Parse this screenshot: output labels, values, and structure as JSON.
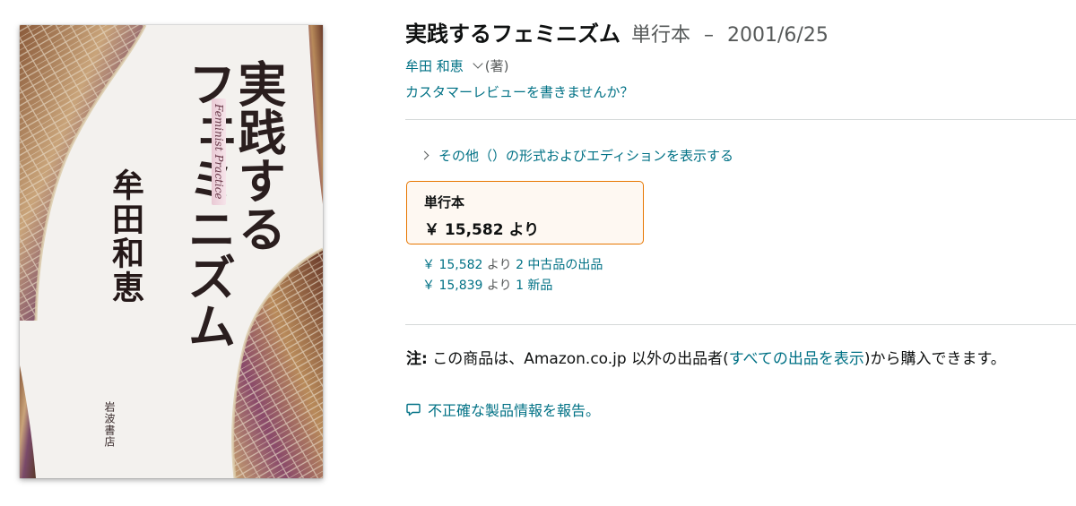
{
  "cover": {
    "title_line1": "実践する",
    "title_line2": "フェミニズム",
    "english_title": "Feminist Practice",
    "author": "牟田和恵",
    "publisher": "岩波書店"
  },
  "product": {
    "title": "実践するフェミニズム",
    "format": "単行本",
    "separator": "–",
    "date": "2001/6/25",
    "author": "牟田 和恵",
    "author_role": "(著)",
    "review_prompt": "カスタマーレビューを書きませんか？"
  },
  "editions": {
    "label": "その他（）の形式およびエディションを表示する"
  },
  "format_box": {
    "label": "単行本",
    "price": "￥ 15,582 より"
  },
  "offers": [
    {
      "price": "￥ 15,582",
      "suffix": "より",
      "count_label": "2 中古品の出品"
    },
    {
      "price": "￥ 15,839",
      "suffix": "より",
      "count_label": "1 新品"
    }
  ],
  "note": {
    "label": "注:",
    "text_before": " この商品は、Amazon.co.jp 以外の出品者(",
    "link": "すべての出品を表示",
    "text_after": ")から購入できます。"
  },
  "report": {
    "label": "不正確な製品情報を報告。",
    "icon": "comment-icon"
  },
  "colors": {
    "link": "#007185",
    "accent_border": "#e77600",
    "muted": "#565959"
  }
}
